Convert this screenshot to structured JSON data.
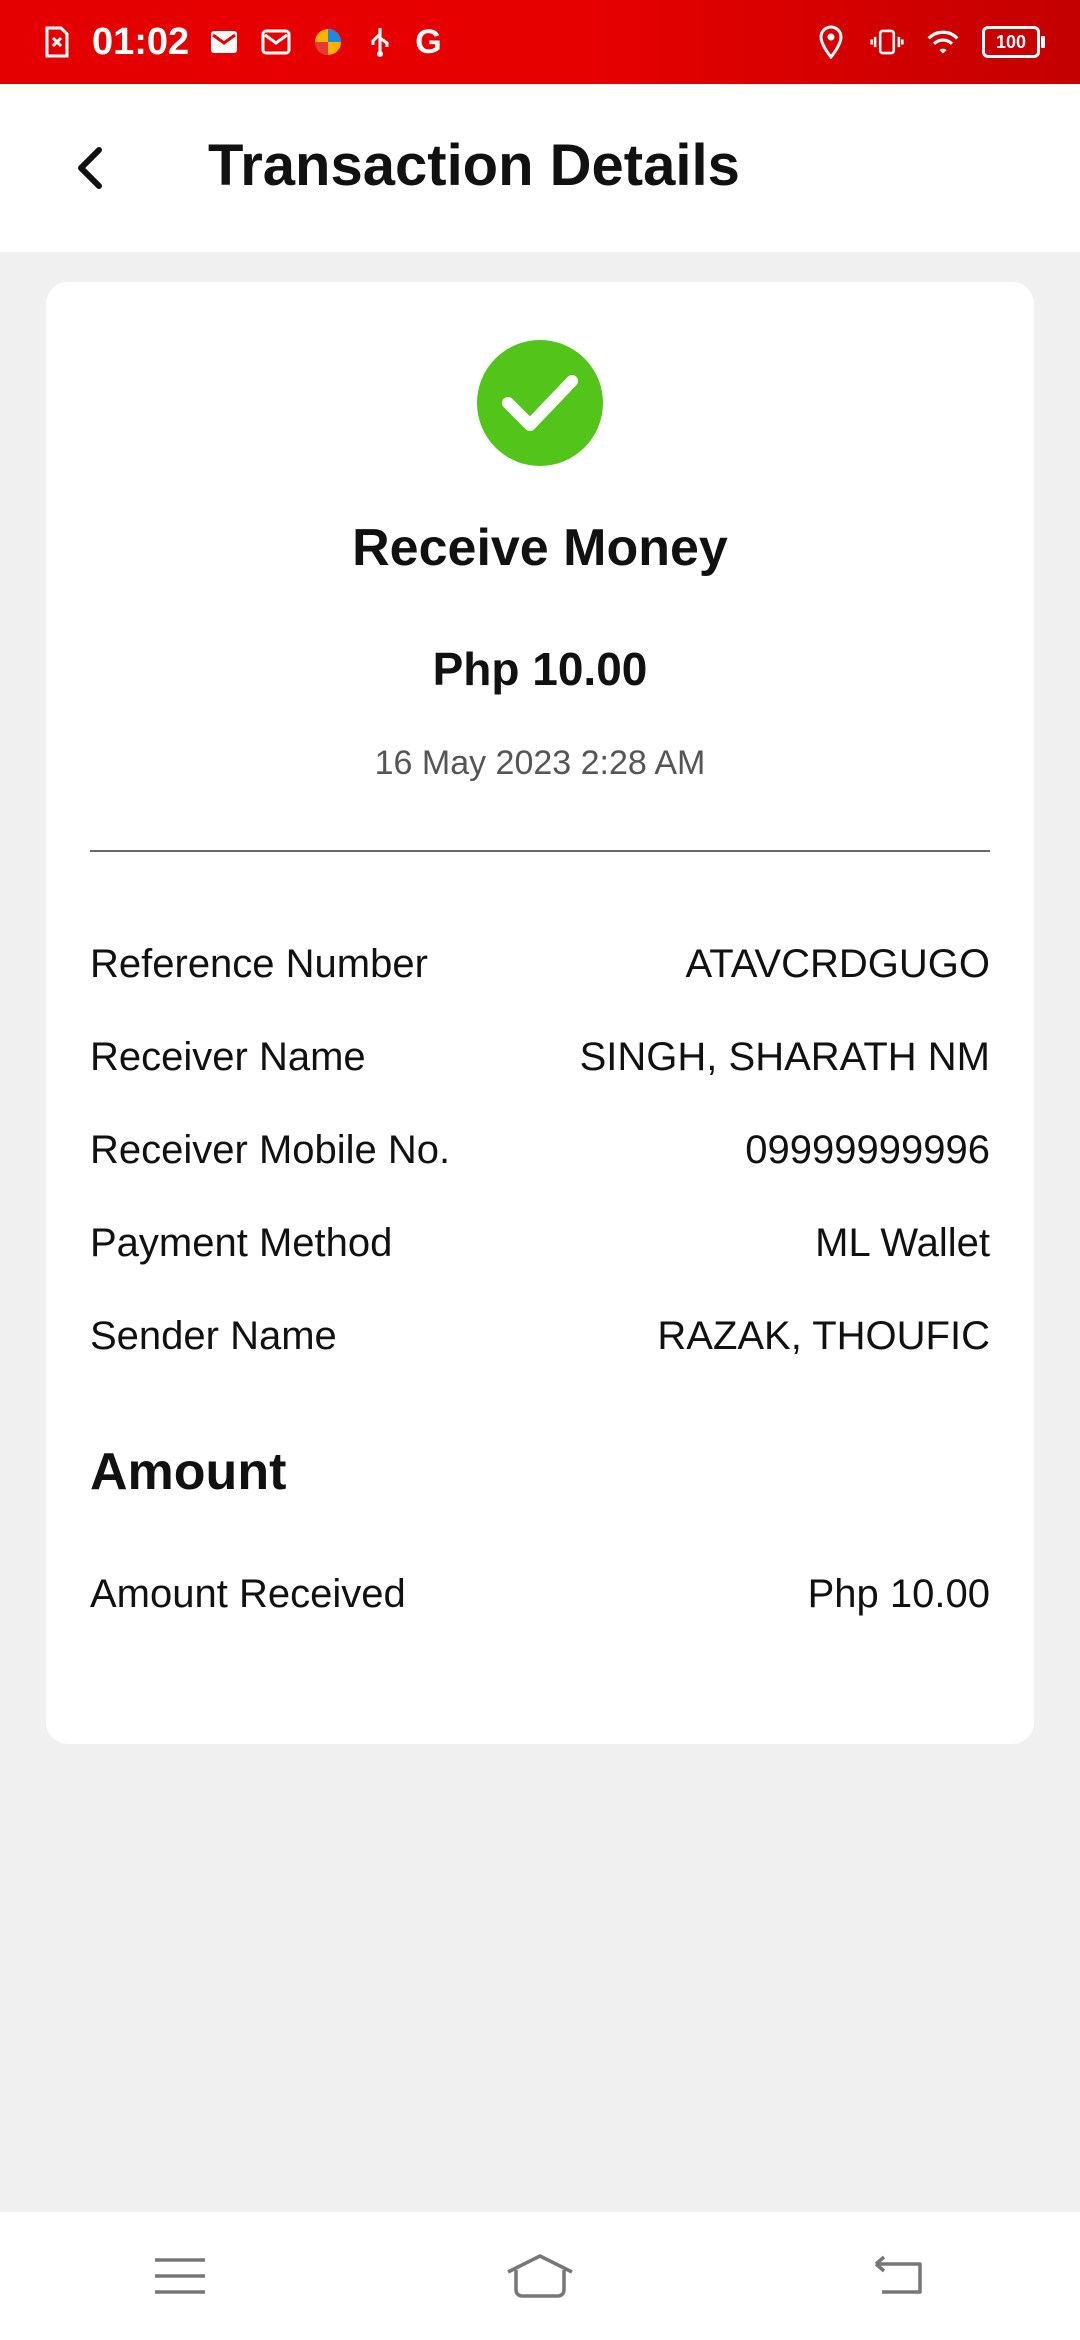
{
  "status_bar": {
    "time": "01:02",
    "g_label": "G",
    "battery": "100"
  },
  "header": {
    "title": "Transaction Details"
  },
  "transaction": {
    "type": "Receive Money",
    "amount": "Php 10.00",
    "datetime": "16 May 2023 2:28 AM",
    "details": [
      {
        "label": "Reference Number",
        "value": "ATAVCRDGUGO"
      },
      {
        "label": "Receiver Name",
        "value": "SINGH, SHARATH NM"
      },
      {
        "label": "Receiver Mobile No.",
        "value": "09999999996"
      },
      {
        "label": "Payment Method",
        "value": "ML Wallet"
      },
      {
        "label": "Sender Name",
        "value": "RAZAK, THOUFIC"
      }
    ],
    "amount_section": {
      "title": "Amount",
      "label": "Amount Received",
      "value": "Php 10.00"
    }
  },
  "colors": {
    "status_bar": "#e50000",
    "success": "#52c41a",
    "background": "#f0f0f0"
  }
}
